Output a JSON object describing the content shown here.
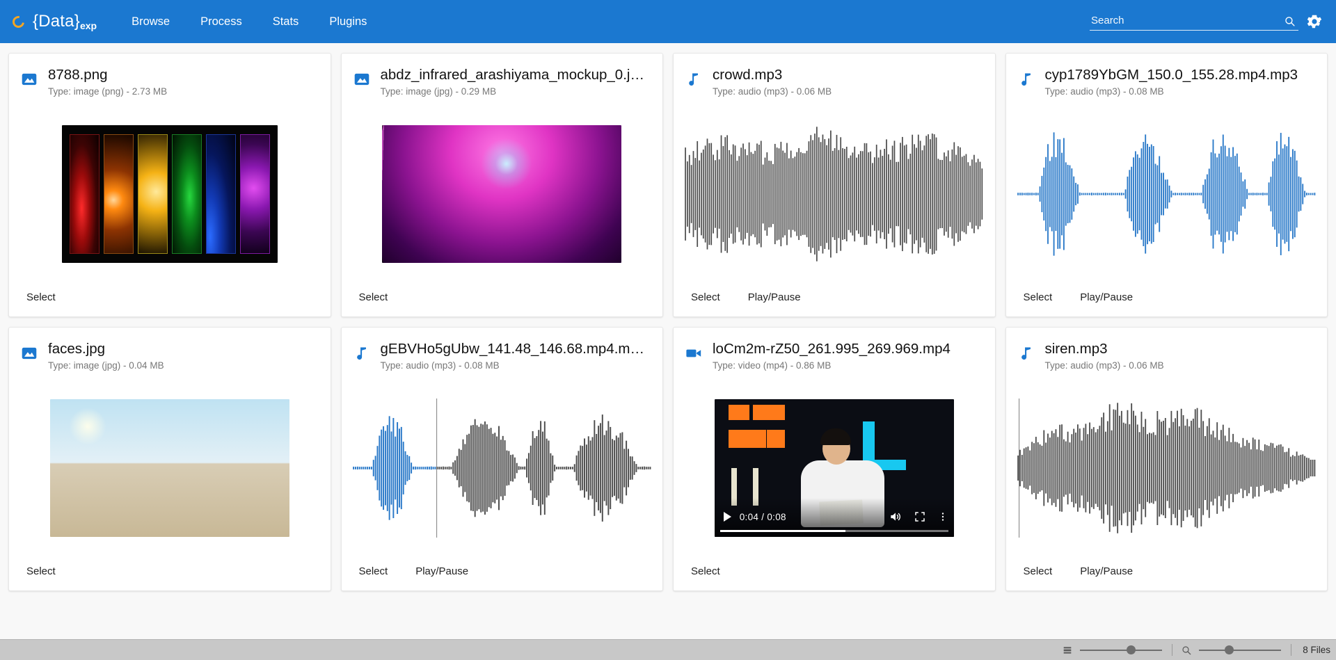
{
  "appbar": {
    "brand_name": "{Data}",
    "brand_sub": "exp",
    "brand_mark_icon": "loading-ring-icon",
    "nav": [
      {
        "label": "Browse"
      },
      {
        "label": "Process"
      },
      {
        "label": "Stats"
      },
      {
        "label": "Plugins"
      }
    ],
    "search": {
      "placeholder": "Search",
      "value": "",
      "icon": "search-icon"
    },
    "settings_icon": "gear-icon",
    "bar_color": "#1b78d0",
    "accent_color": "#f5a623"
  },
  "labels": {
    "select": "Select",
    "play_pause": "Play/Pause"
  },
  "files": [
    {
      "name": "8788.png",
      "meta": "Type: image (png) - 2.73 MB",
      "kind": "image",
      "icon": "image-icon",
      "actions": [
        "Select"
      ]
    },
    {
      "name": "abdz_infrared_arashiyama_mockup_0.j…",
      "meta": "Type: image (jpg) - 0.29 MB",
      "kind": "image",
      "icon": "image-icon",
      "actions": [
        "Select"
      ]
    },
    {
      "name": "crowd.mp3",
      "meta": "Type: audio (mp3) - 0.06 MB",
      "kind": "audio",
      "icon": "music-note-icon",
      "actions": [
        "Select",
        "Play/Pause"
      ],
      "waveform_color": "#4d4d4d"
    },
    {
      "name": "cyp1789YbGM_150.0_155.28.mp4.mp3",
      "meta": "Type: audio (mp3) - 0.08 MB",
      "kind": "audio",
      "icon": "music-note-icon",
      "actions": [
        "Select",
        "Play/Pause"
      ],
      "waveform_color": "#2878c8"
    },
    {
      "name": "faces.jpg",
      "meta": "Type: image (jpg) - 0.04 MB",
      "kind": "image",
      "icon": "image-icon",
      "actions": [
        "Select"
      ]
    },
    {
      "name": "gEBVHo5gUbw_141.48_146.68.mp4.m…",
      "meta": "Type: audio (mp3) - 0.08 MB",
      "kind": "audio",
      "icon": "music-note-icon",
      "actions": [
        "Select",
        "Play/Pause"
      ],
      "waveform_color": "#4d4d4d",
      "waveform_played_color": "#2878c8"
    },
    {
      "name": "loCm2m-rZ50_261.995_269.969.mp4",
      "meta": "Type: video (mp4) - 0.86 MB",
      "kind": "video",
      "icon": "video-camera-icon",
      "actions": [
        "Select"
      ],
      "player": {
        "current_time": "0:04",
        "duration": "0:08",
        "time_display": "0:04 / 0:08",
        "progress_percent": 55,
        "play_icon": "play-icon",
        "volume_icon": "volume-icon",
        "fullscreen_icon": "fullscreen-icon",
        "more_icon": "more-vertical-icon"
      }
    },
    {
      "name": "siren.mp3",
      "meta": "Type: audio (mp3) - 0.06 MB",
      "kind": "audio",
      "icon": "music-note-icon",
      "actions": [
        "Select",
        "Play/Pause"
      ],
      "waveform_color": "#4d4d4d"
    }
  ],
  "statusbar": {
    "list_density_icon": "list-density-icon",
    "density_slider": {
      "percent": 62
    },
    "zoom_icon": "zoom-icon",
    "zoom_slider": {
      "percent": 36
    },
    "file_count": "8 Files"
  }
}
